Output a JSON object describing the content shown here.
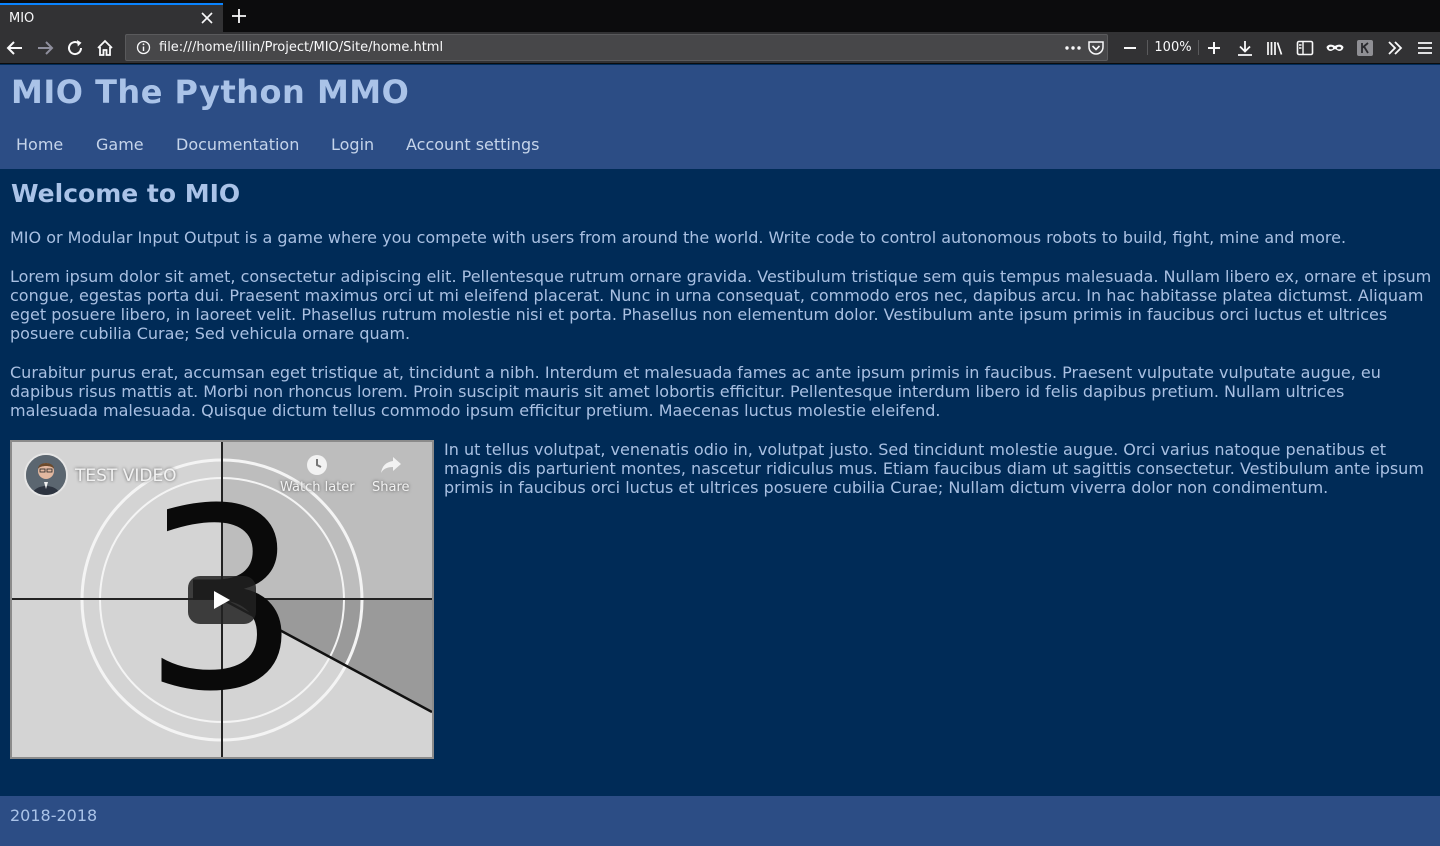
{
  "browser": {
    "tab": {
      "title": "MIO"
    },
    "url": "file:///home/illin/Project/MIO/Site/home.html",
    "zoom": "100%"
  },
  "site": {
    "title": "MIO The Python MMO",
    "nav": [
      "Home",
      "Game",
      "Documentation",
      "Login",
      "Account settings"
    ]
  },
  "main": {
    "heading": "Welcome to MIO",
    "intro": "MIO or Modular Input Output is a game where you compete with users from around the world. Write code to control autonomous robots to build, fight, mine and more.",
    "lorem1": "Lorem ipsum dolor sit amet, consectetur adipiscing elit. Pellentesque rutrum ornare gravida. Vestibulum tristique sem quis tempus malesuada. Nullam libero ex, ornare et ipsum congue, egestas porta dui. Praesent maximus orci ut mi eleifend placerat. Nunc in urna consequat, commodo eros nec, dapibus arcu. In hac habitasse platea dictumst. Aliquam eget posuere libero, in laoreet velit. Phasellus rutrum molestie nisi et porta. Phasellus non elementum dolor. Vestibulum ante ipsum primis in faucibus orci luctus et ultrices posuere cubilia Curae; Sed vehicula ornare quam.",
    "lorem2": "Curabitur purus erat, accumsan eget tristique at, tincidunt a nibh. Interdum et malesuada fames ac ante ipsum primis in faucibus. Praesent vulputate vulputate augue, eu dapibus risus mattis at. Morbi non rhoncus lorem. Proin suscipit mauris sit amet lobortis efficitur. Pellentesque interdum libero id felis dapibus pretium. Nullam ultrices malesuada malesuada. Quisque dictum tellus commodo ipsum efficitur pretium. Maecenas luctus molestie eleifend.",
    "lorem3": "In ut tellus volutpat, venenatis odio in, volutpat justo. Sed tincidunt molestie augue. Orci varius natoque penatibus et magnis dis parturient montes, nascetur ridiculus mus. Etiam faucibus diam ut sagittis consectetur. Vestibulum ante ipsum primis in faucibus orci luctus et ultrices posuere cubilia Curae; Nullam dictum viverra dolor non condimentum."
  },
  "video": {
    "title": "TEST VIDEO",
    "watch_later": "Watch later",
    "share": "Share",
    "countdown_digit": "3"
  },
  "footer": {
    "text": "2018-2018"
  },
  "colors": {
    "header_bg": "#2c4d85",
    "page_bg": "#002b57",
    "title_text": "#aac3e8"
  }
}
